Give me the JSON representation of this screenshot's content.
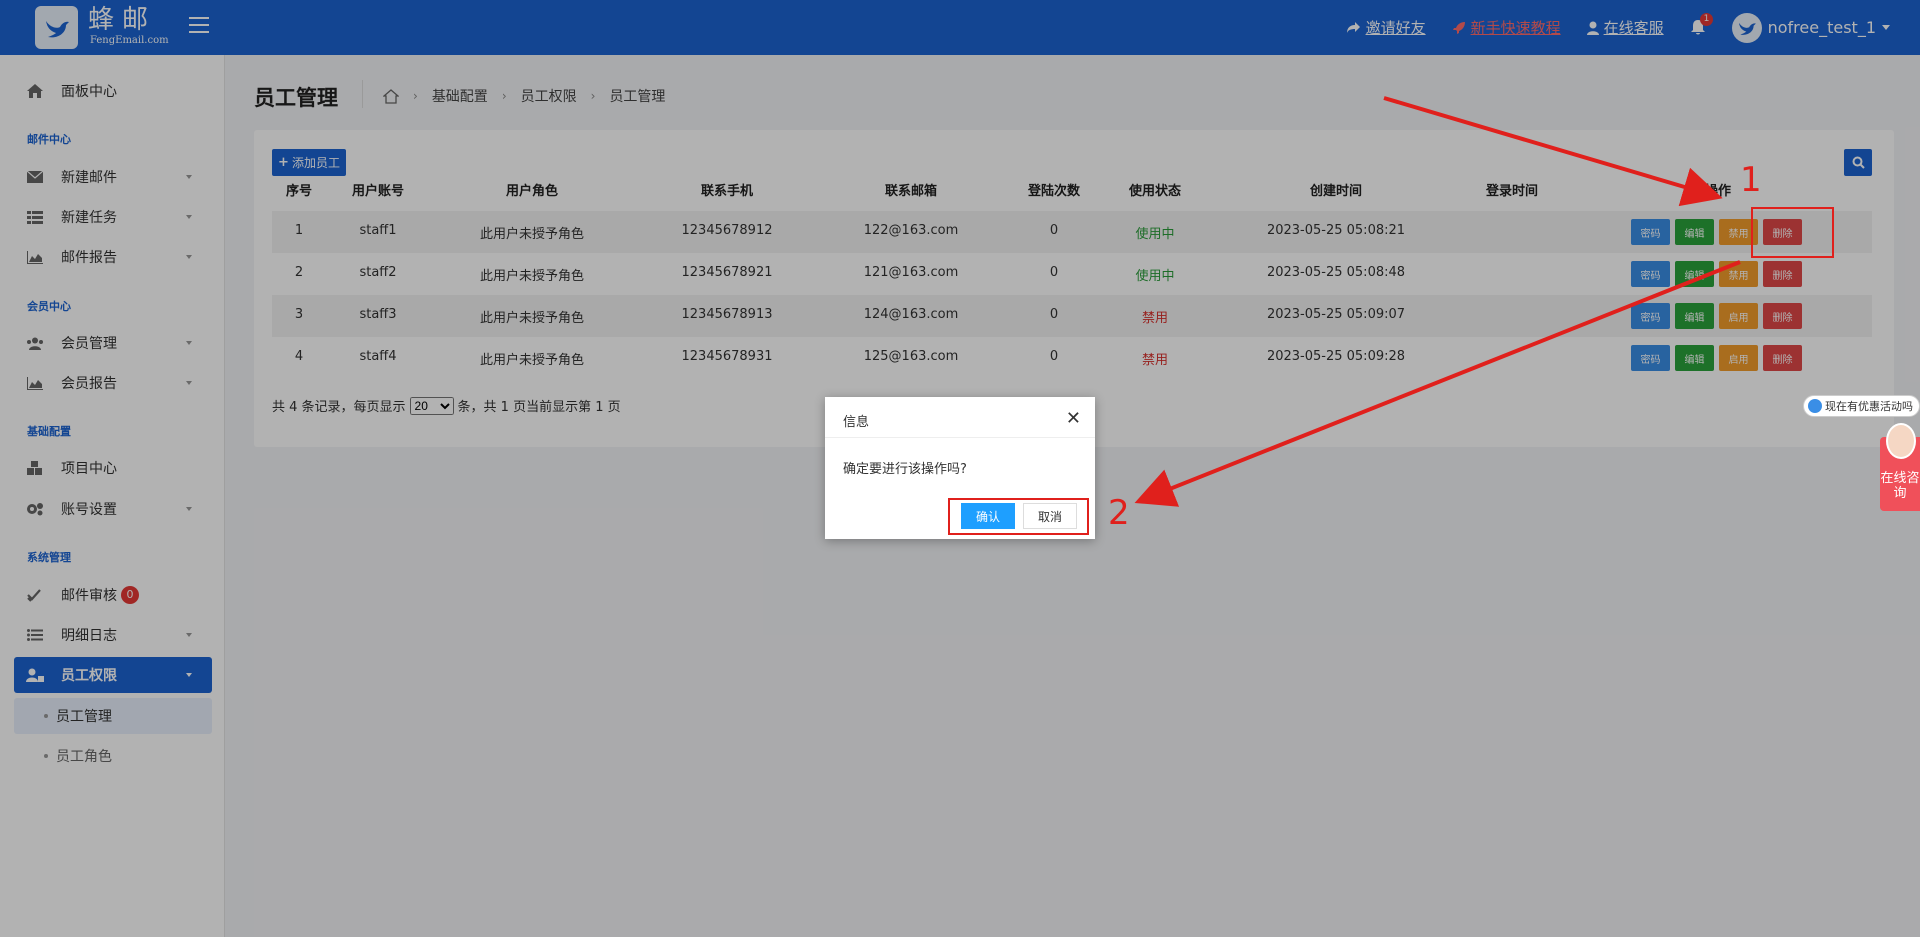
{
  "colors": {
    "primary": "#1c64d2",
    "danger": "#e04848",
    "success": "#2aa33c",
    "warning": "#f39c2b",
    "info": "#3a8ee6"
  },
  "header": {
    "brand_cn": "蜂邮",
    "brand_en": "FengEmail.com",
    "invite": "邀请好友",
    "tutorial": "新手快速教程",
    "support": "在线客服",
    "notification_count": "1",
    "username": "nofree_test_1"
  },
  "sidebar": {
    "dashboard": "面板中心",
    "mail_center": "邮件中心",
    "new_mail": "新建邮件",
    "new_task": "新建任务",
    "mail_report": "邮件报告",
    "member_center": "会员中心",
    "member_manage": "会员管理",
    "member_report": "会员报告",
    "base_config": "基础配置",
    "project_center": "项目中心",
    "account_settings": "账号设置",
    "system_manage": "系统管理",
    "mail_review": "邮件审核",
    "mail_review_count": "0",
    "detail_log": "明细日志",
    "staff_perm": "员工权限",
    "staff_manage": "员工管理",
    "staff_role": "员工角色"
  },
  "page": {
    "title": "员工管理",
    "breadcrumb": [
      "基础配置",
      "员工权限",
      "员工管理"
    ],
    "add_button": "添加员工"
  },
  "table": {
    "headers": [
      "序号",
      "用户账号",
      "用户角色",
      "联系手机",
      "联系邮箱",
      "登陆次数",
      "使用状态",
      "创建时间",
      "登录时间",
      "操作"
    ],
    "rows": [
      {
        "no": "1",
        "account": "staff1",
        "role": "此用户未授予角色",
        "phone": "12345678912",
        "email": "122@163.com",
        "logins": "0",
        "status": "使用中",
        "created": "2023-05-25 05:08:21",
        "last_login": "",
        "toggle": "禁用"
      },
      {
        "no": "2",
        "account": "staff2",
        "role": "此用户未授予角色",
        "phone": "12345678921",
        "email": "121@163.com",
        "logins": "0",
        "status": "使用中",
        "created": "2023-05-25 05:08:48",
        "last_login": "",
        "toggle": "禁用"
      },
      {
        "no": "3",
        "account": "staff3",
        "role": "此用户未授予角色",
        "phone": "12345678913",
        "email": "124@163.com",
        "logins": "0",
        "status": "禁用",
        "created": "2023-05-25 05:09:07",
        "last_login": "",
        "toggle": "启用"
      },
      {
        "no": "4",
        "account": "staff4",
        "role": "此用户未授予角色",
        "phone": "12345678931",
        "email": "125@163.com",
        "logins": "0",
        "status": "禁用",
        "created": "2023-05-25 05:09:28",
        "last_login": "",
        "toggle": "启用"
      }
    ],
    "btn_password": "密码",
    "btn_edit": "编辑",
    "btn_delete": "删除"
  },
  "pagination": {
    "prefix": "共 4 条记录，每页显示",
    "page_size": "20",
    "suffix": "条，共 1 页当前显示第 1 页"
  },
  "dialog": {
    "title": "信息",
    "message": "确定要进行该操作吗?",
    "confirm": "确认",
    "cancel": "取消"
  },
  "annotations": {
    "step1": "1",
    "step2": "2"
  },
  "floating": {
    "promo": "现在有优惠活动吗",
    "consult": "在线咨询"
  }
}
